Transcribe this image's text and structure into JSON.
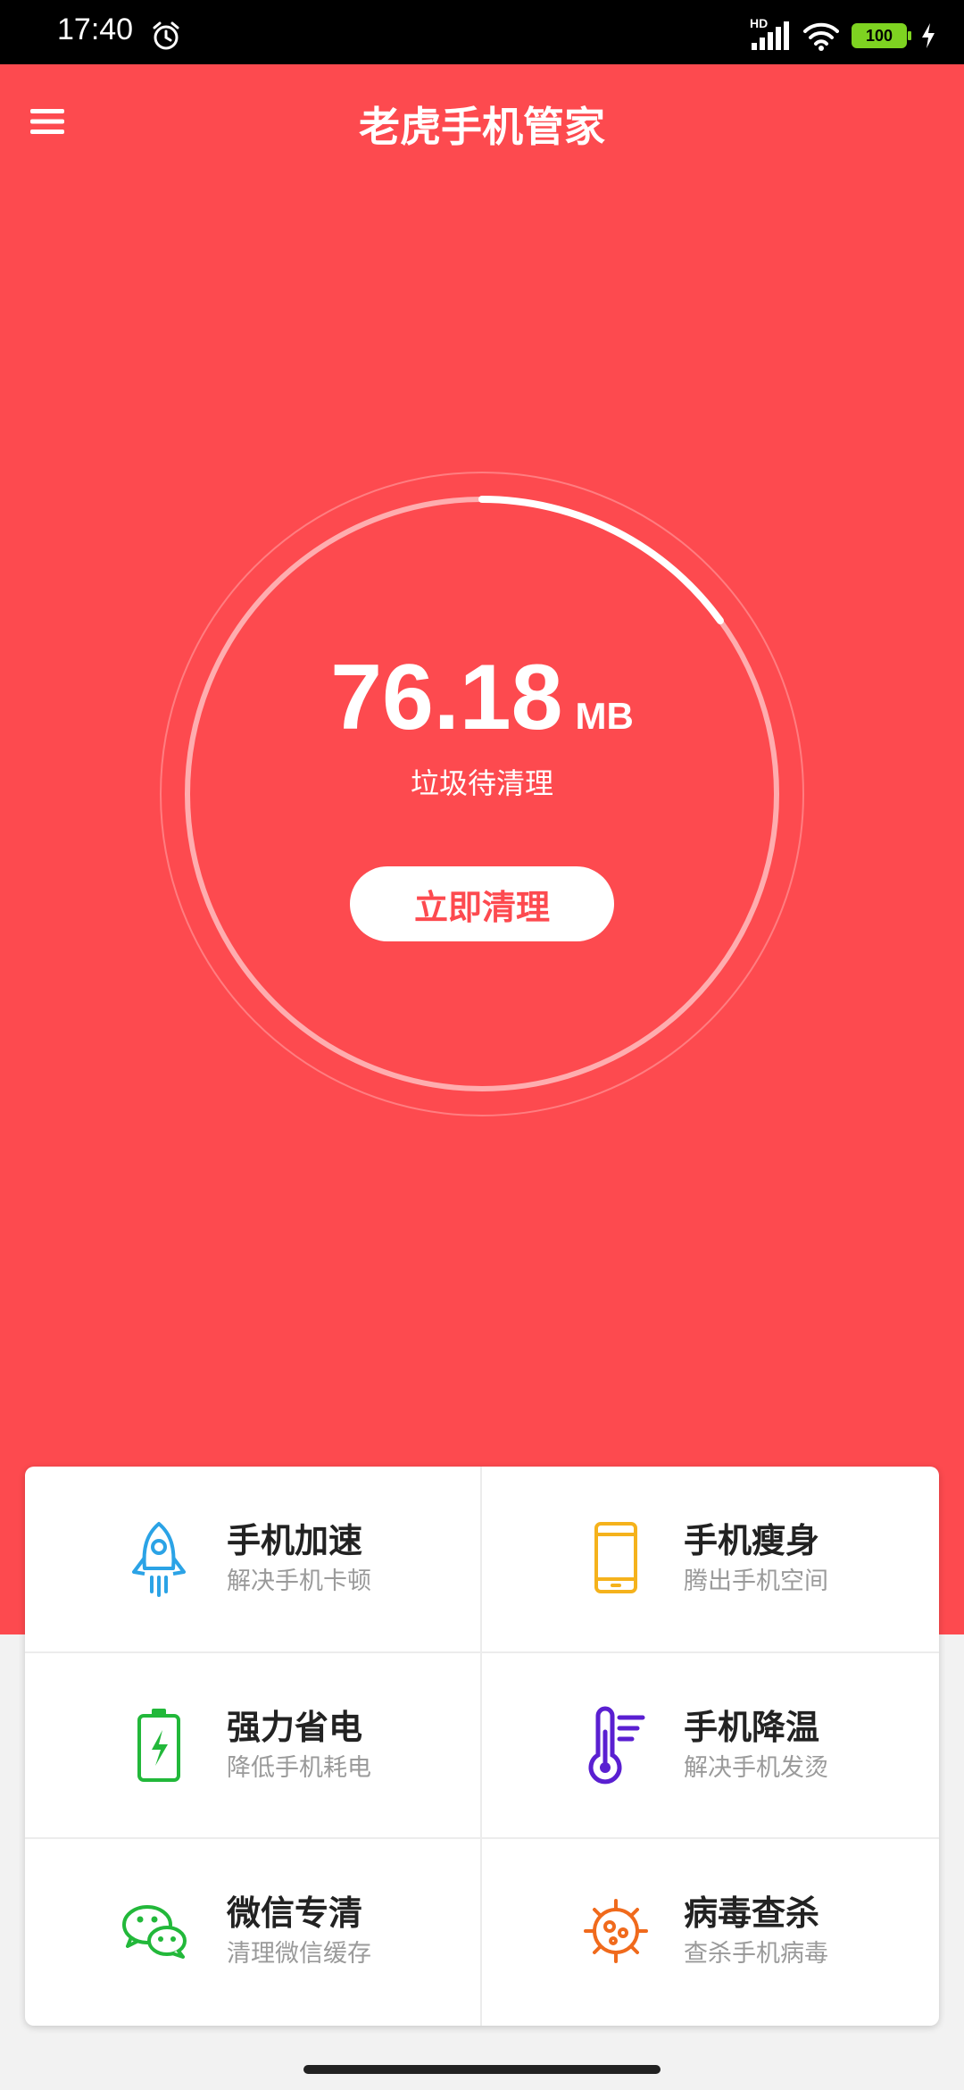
{
  "status_bar": {
    "time": "17:40",
    "network_label": "HD",
    "battery_level": "100",
    "icons": [
      "alarm-icon",
      "signal-icon",
      "wifi-icon",
      "battery-icon",
      "charging-icon"
    ]
  },
  "header": {
    "title": "老虎手机管家",
    "menu_icon": "menu-icon"
  },
  "gauge": {
    "value": "76.18",
    "unit": "MB",
    "caption": "垃圾待清理",
    "progress_fraction": 0.15,
    "button_label": "立即清理"
  },
  "features": [
    {
      "title": "手机加速",
      "subtitle": "解决手机卡顿",
      "icon": "rocket-icon",
      "color": "#2ba3e6"
    },
    {
      "title": "手机瘦身",
      "subtitle": "腾出手机空间",
      "icon": "phone-icon",
      "color": "#f5b21c"
    },
    {
      "title": "强力省电",
      "subtitle": "降低手机耗电",
      "icon": "battery-icon",
      "color": "#22b83a"
    },
    {
      "title": "手机降温",
      "subtitle": "解决手机发烫",
      "icon": "thermometer-icon",
      "color": "#5a1fd1"
    },
    {
      "title": "微信专清",
      "subtitle": "清理微信缓存",
      "icon": "wechat-icon",
      "color": "#22b83a"
    },
    {
      "title": "病毒查杀",
      "subtitle": "查杀手机病毒",
      "icon": "virus-icon",
      "color": "#f06a1c"
    }
  ],
  "colors": {
    "hero_background": "#fd4a4f",
    "card_background": "#ffffff",
    "page_background": "#f2f2f2"
  }
}
